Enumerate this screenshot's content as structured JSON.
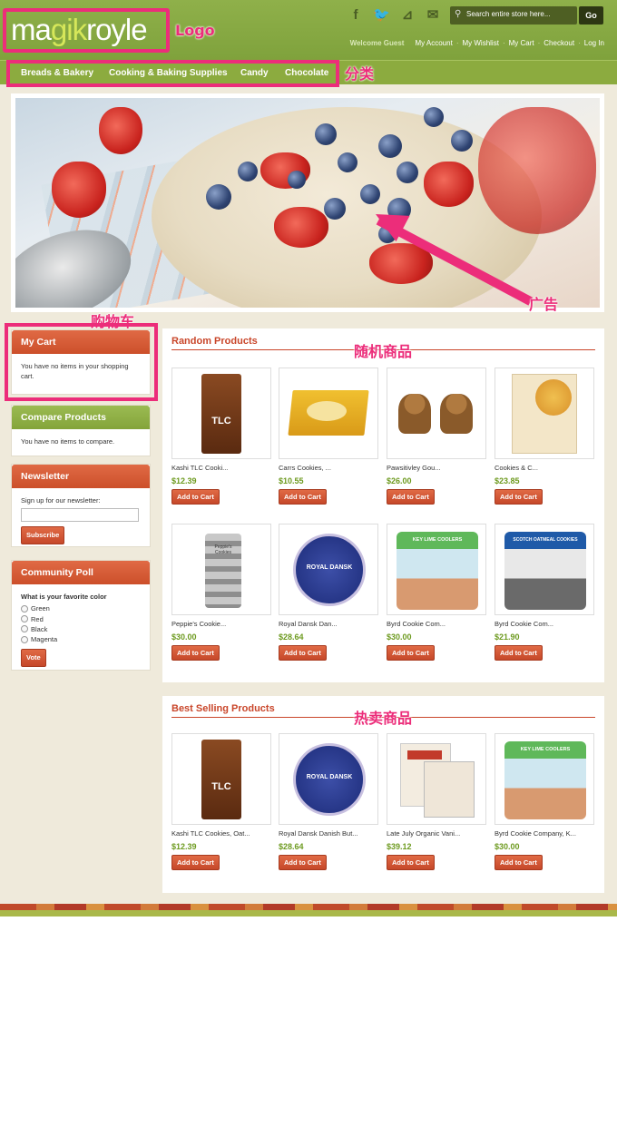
{
  "header": {
    "logo_text": "magikroyle",
    "search_placeholder": "Search entire store here...",
    "go_label": "Go",
    "welcome": "Welcome Guest",
    "links": [
      "My Account",
      "My Wishlist",
      "My Cart",
      "Checkout",
      "Log In"
    ]
  },
  "nav": {
    "items": [
      "Breads & Bakery",
      "Cooking & Baking Supplies",
      "Candy",
      "Chocolate"
    ]
  },
  "annotations": {
    "logo": "Logo",
    "category": "分类",
    "ad": "广告",
    "cart": "购物车",
    "random": "随机商品",
    "bestselling": "热卖商品"
  },
  "sidebar": {
    "cart": {
      "title": "My Cart",
      "text": "You have no items in your shopping cart."
    },
    "compare": {
      "title": "Compare Products",
      "text": "You have no items to compare."
    },
    "newsletter": {
      "title": "Newsletter",
      "label": "Sign up for our newsletter:",
      "button": "Subscribe"
    },
    "poll": {
      "title": "Community Poll",
      "question": "What is your favorite color",
      "options": [
        "Green",
        "Red",
        "Black",
        "Magenta"
      ],
      "button": "Vote"
    }
  },
  "random_products": {
    "title": "Random Products",
    "items": [
      {
        "name": "Kashi TLC Cooki...",
        "price": "$12.39",
        "button": "Add to Cart"
      },
      {
        "name": "Carrs Cookies, ...",
        "price": "$10.55",
        "button": "Add to Cart"
      },
      {
        "name": "Pawsitivley Gou...",
        "price": "$26.00",
        "button": "Add to Cart"
      },
      {
        "name": "Cookies & C...",
        "price": "$23.85",
        "button": "Add to Cart"
      },
      {
        "name": "Peppie's Cookie...",
        "price": "$30.00",
        "button": "Add to Cart"
      },
      {
        "name": "Royal Dansk Dan...",
        "price": "$28.64",
        "button": "Add to Cart"
      },
      {
        "name": "Byrd Cookie Com...",
        "price": "$30.00",
        "button": "Add to Cart"
      },
      {
        "name": "Byrd Cookie Com...",
        "price": "$21.90",
        "button": "Add to Cart"
      }
    ]
  },
  "best_selling": {
    "title": "Best Selling Products",
    "items": [
      {
        "name": "Kashi TLC Cookies, Oat...",
        "price": "$12.39",
        "button": "Add to Cart"
      },
      {
        "name": "Royal Dansk Danish But...",
        "price": "$28.64",
        "button": "Add to Cart"
      },
      {
        "name": "Late July Organic Vani...",
        "price": "$39.12",
        "button": "Add to Cart"
      },
      {
        "name": "Byrd Cookie Company, K...",
        "price": "$30.00",
        "button": "Add to Cart"
      }
    ]
  },
  "product_images": {
    "kashi": "TLC",
    "royal": "ROYAL DANSK",
    "byrd1": "KEY LIME COOLERS",
    "byrd2": "SCOTCH OATMEAL COOKIES",
    "peppie": "Peppie's Cookies"
  }
}
